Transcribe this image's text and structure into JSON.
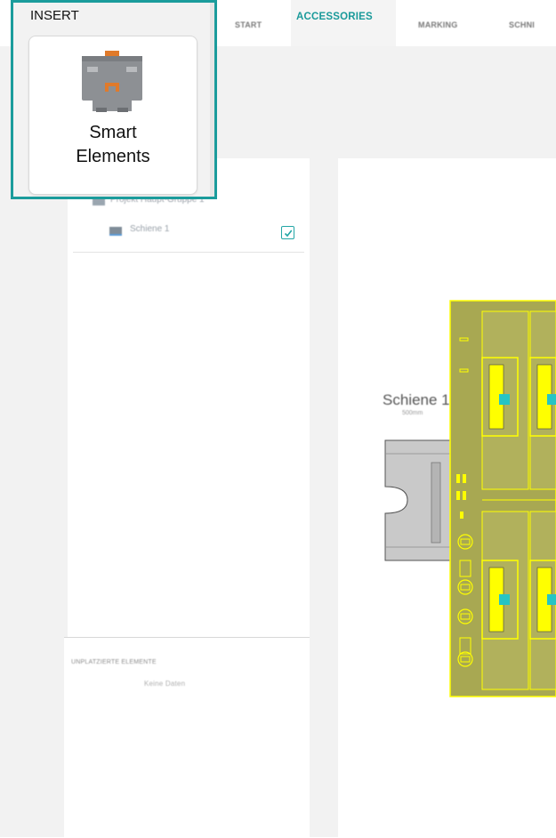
{
  "tabs": [
    {
      "label": "START",
      "active": false
    },
    {
      "label": "ACCESSORIES",
      "active": true
    },
    {
      "label": "MARKING",
      "active": false
    },
    {
      "label": "SCHNI",
      "active": false
    }
  ],
  "insert_panel": {
    "title": "INSERT",
    "button": {
      "line1": "Smart",
      "line2": "Elements",
      "icon": "smart-element-icon"
    }
  },
  "tree": {
    "items": [
      {
        "label": "Projekt Haupt-Gruppe 1",
        "icon": "group-icon"
      },
      {
        "label": "Schiene 1",
        "icon": "rail-icon",
        "checked": true
      }
    ]
  },
  "unplaced": {
    "heading": "UNPLATZIERTE ELEMENTE",
    "empty": "Keine Daten"
  },
  "canvas": {
    "rail_label": "Schiene 1",
    "rail_sub": "500mm"
  },
  "colors": {
    "accent": "#1a9a9a",
    "highlight_yellow": "#ffff00",
    "terminal_fill": "#a8a852",
    "rail_grey": "#c8c8c8",
    "contact_cyan": "#26c4c4"
  }
}
